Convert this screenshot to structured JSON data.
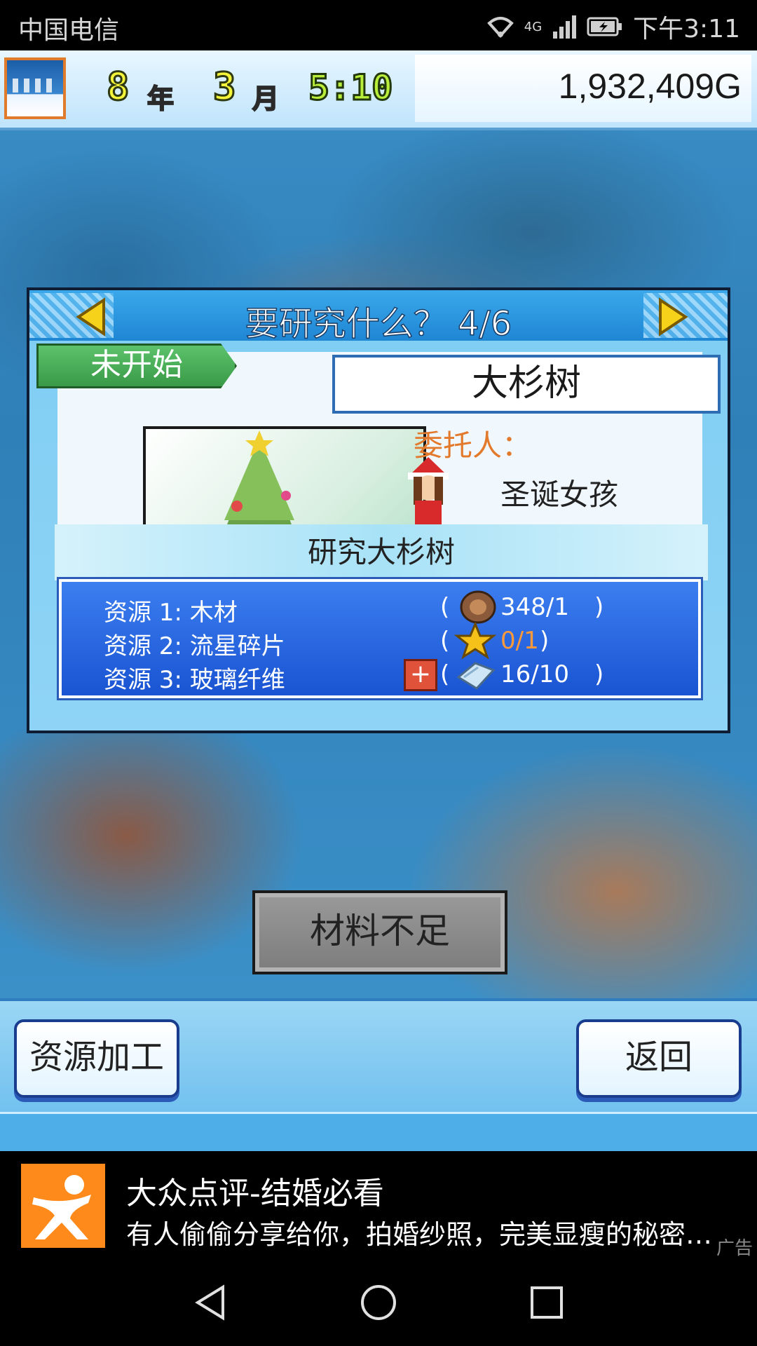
{
  "status_bar": {
    "carrier": "中国电信",
    "network": "4G",
    "time": "下午3:11",
    "icons": [
      "wifi-icon",
      "signal-icon",
      "battery-charging-icon"
    ]
  },
  "top_bar": {
    "year_num": "8",
    "year_unit": "年",
    "month_num": "3",
    "month_unit": "月",
    "clock": "5:10",
    "money": "1,932,409G",
    "season_icon": "winter-icon"
  },
  "dialog": {
    "title": "要研究什么？ 4/6",
    "status_tag": "未开始",
    "item_name": "大杉树",
    "client_label": "委托人：",
    "client_name": "圣诞女孩",
    "research_label": "研究大杉树",
    "resources": [
      {
        "label": "资源 1: 木材",
        "paren_open": "(",
        "count": "348/1",
        "paren_close": ")",
        "icon": "wood-log-icon"
      },
      {
        "label": "资源 2: 流星碎片",
        "paren_open": "(",
        "count": "0/1",
        "paren_close": ")",
        "icon": "star-icon",
        "insufficient": true
      },
      {
        "label": "资源 3: 玻璃纤维",
        "paren_open": "(",
        "count": "16/10",
        "paren_close": ")",
        "icon": "glass-fiber-icon",
        "plus": "+"
      }
    ],
    "action_button": "材料不足"
  },
  "bottom": {
    "left_button": "资源加工",
    "right_button": "返回"
  },
  "ad": {
    "title": "大众点评-结婚必看",
    "desc": "有人偷偷分享给你，拍婚纱照，完美显瘦的秘密…",
    "label": "广告"
  },
  "colors": {
    "accent_blue": "#1f86d4",
    "insufficient_orange": "#ff9a3a",
    "status_green": "#3a9a47"
  }
}
